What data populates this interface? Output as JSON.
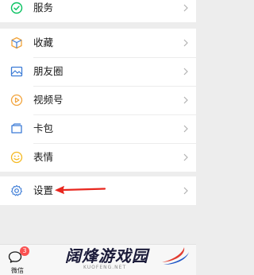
{
  "menu": {
    "services": {
      "label": "服务",
      "icon": "services-icon"
    },
    "items": [
      {
        "label": "收藏",
        "icon": "favorites-icon"
      },
      {
        "label": "朋友圈",
        "icon": "moments-icon"
      },
      {
        "label": "视频号",
        "icon": "channels-icon"
      },
      {
        "label": "卡包",
        "icon": "card-wallet-icon"
      },
      {
        "label": "表情",
        "icon": "stickers-icon"
      }
    ],
    "settings": {
      "label": "设置",
      "icon": "settings-icon"
    }
  },
  "tabbar": {
    "wechat": {
      "label": "微信",
      "badge": "3"
    }
  },
  "watermark": {
    "title": "阔烽游戏园",
    "subtitle": "KUOFENG.NET"
  },
  "colors": {
    "green": "#07c160",
    "orange": "#f2a33a",
    "blue": "#3b7bd6",
    "yellow": "#f5b921",
    "arrow_red": "#e8271f",
    "badge_red": "#fa5151"
  }
}
